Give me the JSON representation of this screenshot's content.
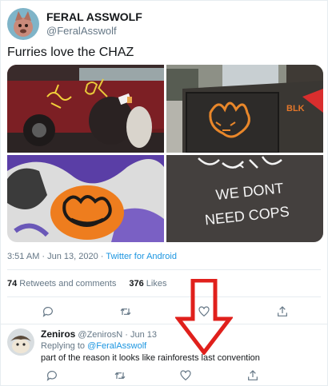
{
  "tweet": {
    "display_name": "FERAL ASSWOLF",
    "handle": "@FeralAsswolf",
    "text": "Furries love the CHAZ",
    "timestamp": "3:51 AM · Jun 13, 2020",
    "source_sep": " · ",
    "source": "Twitter for Android",
    "retweets_count": "74",
    "retweets_label": " Retweets and comments",
    "likes_count": "376",
    "likes_label": " Likes",
    "media": [
      {
        "kind": "photo",
        "description_icon": "graffiti-car-photo"
      },
      {
        "kind": "photo",
        "description_icon": "graffiti-barricade-photo",
        "graffiti_text": "BLK"
      },
      {
        "kind": "photo",
        "description_icon": "graffiti-wall-photo"
      },
      {
        "kind": "photo",
        "description_icon": "graffiti-sign-photo",
        "graffiti_line1": "WE DONT",
        "graffiti_line2": "NEED COPS"
      }
    ]
  },
  "reply": {
    "display_name": "Zeniros",
    "handle": "@ZenirosN",
    "date_sep": " · ",
    "date": "Jun 13",
    "replying_prefix": "Replying to ",
    "replying_to": "@FeralAsswolf",
    "text": "part of the reason it looks like rainforests last convention"
  },
  "icons": {
    "reply": "comment-icon",
    "retweet": "retweet-icon",
    "like": "heart-icon",
    "share": "share-icon"
  },
  "colors": {
    "link": "#1b95e0",
    "secondary_text": "#657786",
    "primary_text": "#14171a",
    "divider": "#e6ecf0",
    "annotation_arrow": "#e0201c"
  }
}
